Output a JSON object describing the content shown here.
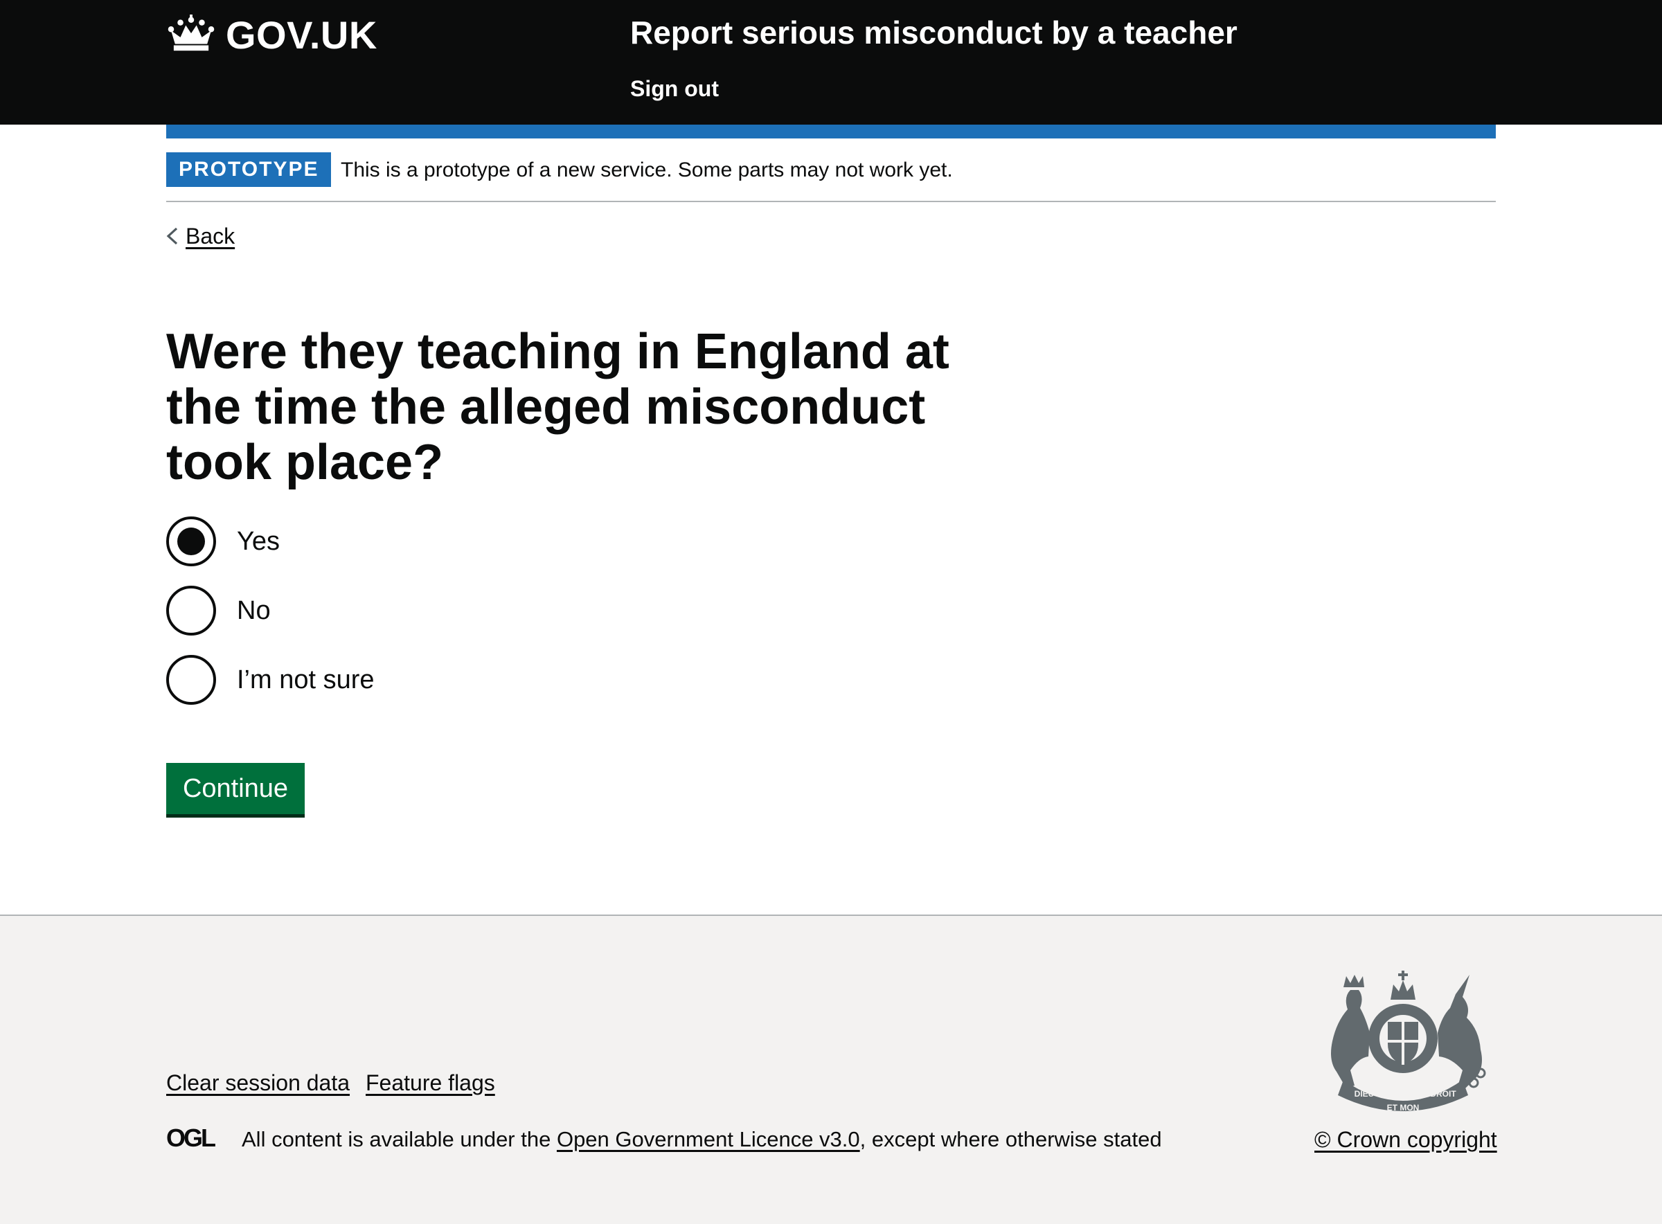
{
  "header": {
    "logo_text": "GOV.UK",
    "service_name": "Report serious misconduct by a teacher",
    "sign_out": "Sign out"
  },
  "phase_banner": {
    "tag": "PROTOTYPE",
    "text": "This is a prototype of a new service. Some parts may not work yet."
  },
  "back_link": "Back",
  "question": "Were they teaching in England at the time the alleged misconduct took place?",
  "options": [
    {
      "label": "Yes",
      "checked": true
    },
    {
      "label": "No",
      "checked": false
    },
    {
      "label": "I’m not sure",
      "checked": false
    }
  ],
  "continue_label": "Continue",
  "footer": {
    "links": [
      "Clear session data",
      "Feature flags"
    ],
    "licence_prefix": "All content is available under the ",
    "licence_link": "Open Government Licence v3.0",
    "licence_suffix": ", except where otherwise stated",
    "copyright": "© Crown copyright",
    "ogl_logo_text": "OGL",
    "crest_motto": [
      "DIEU",
      "ET MON",
      "DROIT"
    ]
  },
  "colors": {
    "header_bg": "#0b0c0c",
    "brand_blue": "#1d70b8",
    "button_green": "#00703c",
    "footer_bg": "#f3f2f1"
  },
  "icons": [
    "crown-icon",
    "chevron-left-icon",
    "ogl-logo",
    "royal-coat-of-arms"
  ]
}
